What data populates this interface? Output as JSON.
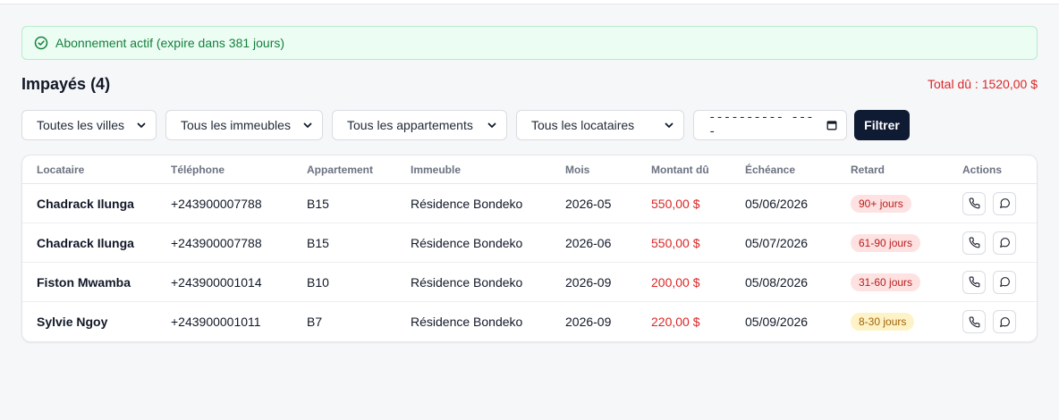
{
  "banner": {
    "text": "Abonnement actif (expire dans 381 jours)"
  },
  "header": {
    "title": "Impayés",
    "count": "(4)",
    "total": "Total dû : 1520,00 $"
  },
  "filters": {
    "city": "Toutes les villes",
    "building": "Tous les immeubles",
    "apartment": "Tous les appartements",
    "tenant": "Tous les locataires",
    "date": "---------- ----",
    "button": "Filtrer"
  },
  "table": {
    "headers": {
      "tenant": "Locataire",
      "phone": "Téléphone",
      "apartment": "Appartement",
      "building": "Immeuble",
      "month": "Mois",
      "amount": "Montant dû",
      "due": "Échéance",
      "late": "Retard",
      "actions": "Actions"
    },
    "rows": [
      {
        "tenant": "Chadrack Ilunga",
        "phone": "+243900007788",
        "apartment": "B15",
        "building": "Résidence Bondeko",
        "month": "2026-05",
        "amount": "550,00 $",
        "due": "05/06/2026",
        "late": "90+ jours"
      },
      {
        "tenant": "Chadrack Ilunga",
        "phone": "+243900007788",
        "apartment": "B15",
        "building": "Résidence Bondeko",
        "month": "2026-06",
        "amount": "550,00 $",
        "due": "05/07/2026",
        "late": "61-90 jours"
      },
      {
        "tenant": "Fiston Mwamba",
        "phone": "+243900001014",
        "apartment": "B10",
        "building": "Résidence Bondeko",
        "month": "2026-09",
        "amount": "200,00 $",
        "due": "05/08/2026",
        "late": "31-60 jours"
      },
      {
        "tenant": "Sylvie Ngoy",
        "phone": "+243900001011",
        "apartment": "B7",
        "building": "Résidence Bondeko",
        "month": "2026-09",
        "amount": "220,00 $",
        "due": "05/09/2026",
        "late": "8-30 jours"
      }
    ]
  },
  "colors": {
    "accent": "#0f1a33",
    "danger": "#dc2626",
    "success": "#15803d",
    "warning": "#a16207"
  },
  "icons": {
    "banner": "check-circle-icon",
    "call": "phone-icon",
    "message": "message-circle-icon",
    "dropdown": "chevron-down-icon",
    "date": "calendar-icon"
  }
}
